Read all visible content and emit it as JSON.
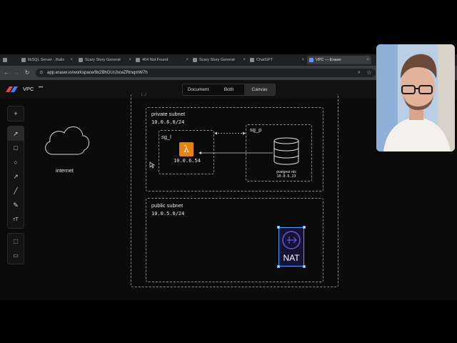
{
  "browser": {
    "tabs": [
      {
        "label": "libSQL Server - Rails",
        "active": false
      },
      {
        "label": "Scary Story Generat",
        "active": false
      },
      {
        "label": "404 Not Found",
        "active": false
      },
      {
        "label": "Scary Story Generat",
        "active": false
      },
      {
        "label": "ChatGPT",
        "active": false
      },
      {
        "label": "VPC — Eraser",
        "active": true
      }
    ],
    "url": "app.eraser.io/workspace/9x2BhGUrJsceZRmqmW7h"
  },
  "app": {
    "title": "VPC",
    "more": "•••",
    "view_modes": [
      "Document",
      "Both",
      "Canvas"
    ],
    "selected_view": "Canvas"
  },
  "toolbar": {
    "tools": [
      "add-icon",
      "pointer-icon",
      "rectangle-icon",
      "circle-icon",
      "arrow-icon",
      "line-icon",
      "pen-icon",
      "text-icon"
    ],
    "extra": [
      "frame-icon",
      "comment-icon"
    ]
  },
  "diagram": {
    "internet_label": "internet",
    "private_subnet": {
      "title": "private subnet",
      "cidr": "10.0.6.0/24"
    },
    "sg_l": {
      "title": "sg_l",
      "ip": "10.0.6.54"
    },
    "sg_p": {
      "title": "sg_p",
      "db_label": "postgres rds",
      "db_ip": "10.0.6.23"
    },
    "public_subnet": {
      "title": "public subnet",
      "cidr": "10.0.5.0/24"
    },
    "nat_label": "NAT",
    "colors": {
      "lambda": "#e8820c",
      "nat": "#3b2a8f",
      "selection": "#4da3ff"
    }
  }
}
